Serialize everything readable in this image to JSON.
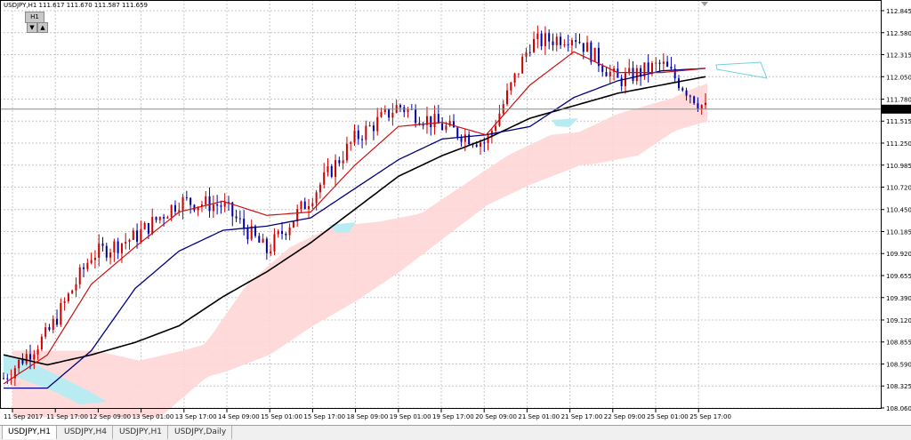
{
  "header": {
    "info": "USDJPY,H1  111.617 111.670 111.587 111.659",
    "timeframe_badge": "H1",
    "down_arrow": "▼",
    "up_arrow": "▲"
  },
  "price_axis": {
    "labels": [
      "112.845",
      "112.580",
      "112.315",
      "112.050",
      "111.780",
      "111.515",
      "111.250",
      "110.985",
      "110.720",
      "110.450",
      "110.185",
      "109.920",
      "109.655",
      "109.390",
      "109.120",
      "108.855",
      "108.590",
      "108.325",
      "108.060"
    ],
    "current_price": "111.659"
  },
  "time_axis": {
    "labels": [
      "11 Sep 2017",
      "11 Sep 17:00",
      "12 Sep 09:00",
      "13 Sep 01:00",
      "13 Sep 17:00",
      "14 Sep 09:00",
      "15 Sep 01:00",
      "15 Sep 17:00",
      "18 Sep 09:00",
      "19 Sep 01:00",
      "19 Sep 17:00",
      "20 Sep 09:00",
      "21 Sep 01:00",
      "21 Sep 17:00",
      "22 Sep 09:00",
      "25 Sep 01:00",
      "25 Sep 17:00"
    ]
  },
  "tabs": [
    {
      "label": "USDJPY,H1",
      "active": true
    },
    {
      "label": "USDJPY,H4",
      "active": false
    },
    {
      "label": "USDJPY,H1",
      "active": false
    },
    {
      "label": "USDJPY,Daily",
      "active": false
    }
  ],
  "chart_data": {
    "type": "line",
    "series": [
      {
        "name": "",
        "values": []
      }
    ],
    "ylim": [
      108.06,
      112.845
    ],
    "grid": true,
    "colors": {
      "bull_candle": "#cc0000",
      "bear_candle": "#0000aa",
      "ma_fast": "#cc1111",
      "ma_mid": "#00007f",
      "ma_slow": "#000000",
      "cloud_bull": "#ffd6d6",
      "cloud_bear": "#b9ecf2",
      "grid": "#c8c8c8",
      "price_line": "#8a8a8a"
    },
    "x": [
      "11 Sep 2017",
      "11 Sep 17:00",
      "12 Sep 09:00",
      "13 Sep 01:00",
      "13 Sep 17:00",
      "14 Sep 09:00",
      "15 Sep 01:00",
      "15 Sep 17:00",
      "18 Sep 09:00",
      "19 Sep 01:00",
      "19 Sep 17:00",
      "20 Sep 09:00",
      "21 Sep 01:00",
      "21 Sep 17:00",
      "22 Sep 09:00",
      "25 Sep 01:00",
      "25 Sep 17:00"
    ],
    "close": [
      108.42,
      108.95,
      109.9,
      110.12,
      110.55,
      110.5,
      109.95,
      110.6,
      111.3,
      111.7,
      111.45,
      111.25,
      112.45,
      112.55,
      112.0,
      112.2,
      111.66
    ],
    "ma_fast": [
      108.35,
      108.7,
      109.55,
      110.0,
      110.42,
      110.55,
      110.38,
      110.42,
      110.98,
      111.45,
      111.5,
      111.35,
      111.95,
      112.35,
      112.1,
      112.1,
      112.15
    ],
    "ma_mid": [
      108.3,
      108.3,
      108.75,
      109.5,
      109.95,
      110.2,
      110.25,
      110.35,
      110.7,
      111.05,
      111.3,
      111.35,
      111.45,
      111.8,
      112.0,
      112.12,
      112.15
    ],
    "ma_slow": [
      108.7,
      108.58,
      108.7,
      108.85,
      109.05,
      109.4,
      109.7,
      110.05,
      110.45,
      110.85,
      111.1,
      111.3,
      111.55,
      111.7,
      111.85,
      111.95,
      112.05
    ]
  }
}
